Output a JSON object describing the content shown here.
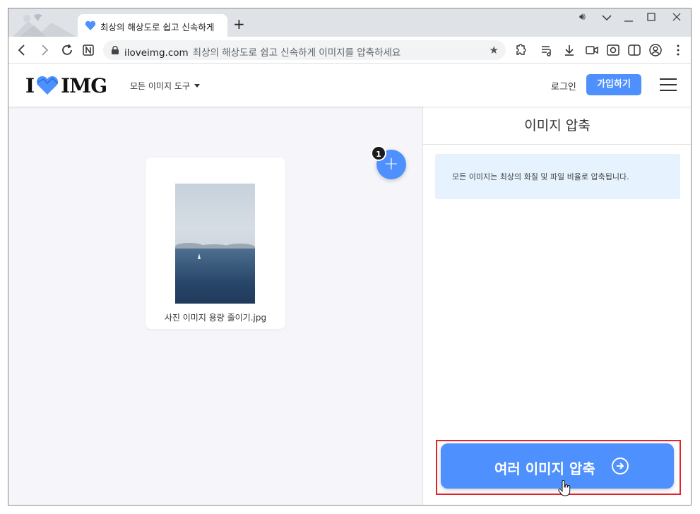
{
  "browser": {
    "tab_title": "최상의 해상도로 쉽고 신속하게",
    "new_tab_symbol": "+",
    "url_host": "iloveimg.com",
    "url_title": "최상의 해상도로 쉽고 신속하게 이미지를 압축하세요"
  },
  "site": {
    "logo_left": "I",
    "logo_right": "IMG",
    "tools_menu_label": "모든 이미지 도구",
    "login_label": "로그인",
    "signup_label": "가입하기",
    "brand_color": "#4d90fe"
  },
  "workspace": {
    "file_count": "1",
    "add_symbol": "+",
    "files": [
      {
        "name": "사진 이미지 용량 줄이기.jpg"
      }
    ]
  },
  "sidebar": {
    "title": "이미지 압축",
    "info_text": "모든 이미지는 최상의 화질 및 파일 비율로 압축됩니다.",
    "compress_button_label": "여러 이미지 압축",
    "highlight_color": "#e5212a"
  }
}
